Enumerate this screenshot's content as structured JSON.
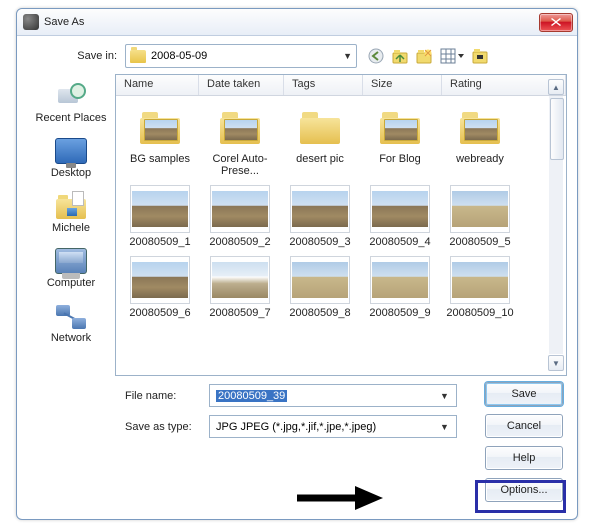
{
  "title": "Save As",
  "labels": {
    "saveIn": "Save in:",
    "fileName": "File name:",
    "saveAsType": "Save as type:"
  },
  "saveIn": "2008-05-09",
  "columns": [
    "Name",
    "Date taken",
    "Tags",
    "Size",
    "Rating"
  ],
  "sidebar": [
    "Recent Places",
    "Desktop",
    "Michele",
    "Computer",
    "Network"
  ],
  "items": [
    {
      "name": "BG samples",
      "kind": "folder",
      "preview": "sky"
    },
    {
      "name": "Corel Auto-Prese...",
      "kind": "folder",
      "preview": "sky"
    },
    {
      "name": "desert pic",
      "kind": "folder",
      "preview": "blank"
    },
    {
      "name": "For Blog",
      "kind": "folder",
      "preview": "sky"
    },
    {
      "name": "webready",
      "kind": "folder",
      "preview": "sky"
    },
    {
      "name": "20080509_1",
      "kind": "image",
      "preview": "sky"
    },
    {
      "name": "20080509_2",
      "kind": "image",
      "preview": "sky"
    },
    {
      "name": "20080509_3",
      "kind": "image",
      "preview": "sky"
    },
    {
      "name": "20080509_4",
      "kind": "image",
      "preview": "sky"
    },
    {
      "name": "20080509_5",
      "kind": "image",
      "preview": "sky3"
    },
    {
      "name": "20080509_6",
      "kind": "image",
      "preview": "sky"
    },
    {
      "name": "20080509_7",
      "kind": "image",
      "preview": "sky2"
    },
    {
      "name": "20080509_8",
      "kind": "image",
      "preview": "sky3"
    },
    {
      "name": "20080509_9",
      "kind": "image",
      "preview": "sky3"
    },
    {
      "name": "20080509_10",
      "kind": "image",
      "preview": "sky3"
    }
  ],
  "fileName": "20080509_39",
  "saveAsType": "JPG JPEG  (*.jpg,*.jif,*.jpe,*.jpeg)",
  "buttons": {
    "save": "Save",
    "cancel": "Cancel",
    "help": "Help",
    "options": "Options..."
  }
}
